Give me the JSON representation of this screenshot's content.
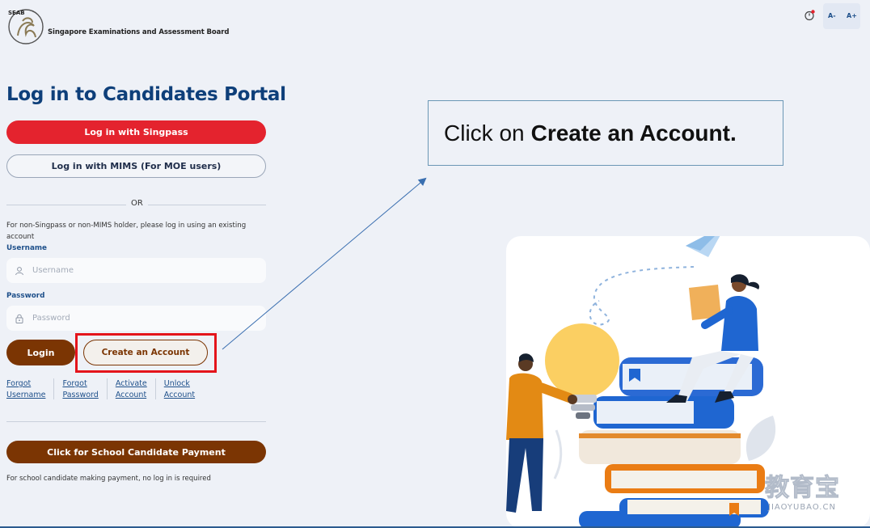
{
  "header": {
    "logo_text": "SEAB",
    "brand": "Singapore Examinations and Assessment Board",
    "font_decrease": "A-",
    "font_increase": "A+"
  },
  "login": {
    "title": "Log in to Candidates Portal",
    "singpass_button": "Log in with Singpass",
    "mims_button": "Log in with MIMS (For MOE users)",
    "or_text": "OR",
    "hint": "For non-Singpass or non-MIMS holder, please log in using an existing account",
    "username_label": "Username",
    "username_placeholder": "Username",
    "password_label": "Password",
    "password_placeholder": "Password",
    "login_button": "Login",
    "create_account_button": "Create an Account",
    "links": {
      "forgot_username_1": "Forgot",
      "forgot_username_2": "Username",
      "forgot_password_1": "Forgot",
      "forgot_password_2": "Password",
      "activate_1": "Activate",
      "activate_2": "Account",
      "unlock_1": "Unlock",
      "unlock_2": "Account"
    },
    "payment_button": "Click for School Candidate Payment",
    "payment_note": "For school candidate making payment, no log in is required"
  },
  "callout": {
    "prefix": "Click on",
    "emphasis": "Create an Account."
  },
  "watermark": {
    "cn": "教育宝",
    "en": "JIAOYUBAO.CN"
  },
  "colors": {
    "brand_blue": "#0e3f7a",
    "singpass_red": "#e4232e",
    "brown": "#7b3503",
    "highlight_red": "#e4141b"
  }
}
